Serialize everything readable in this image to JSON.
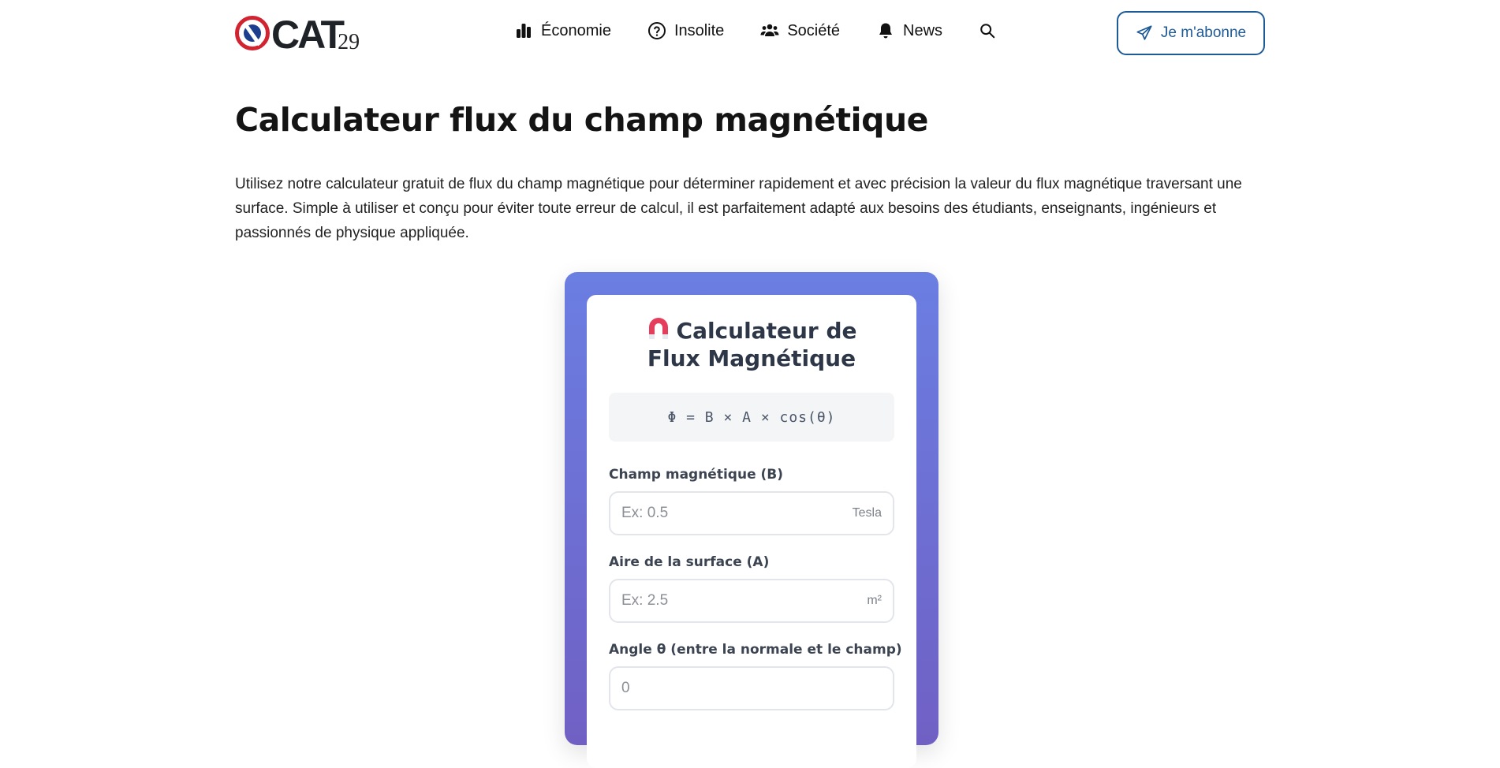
{
  "header": {
    "logo_text": "CAT",
    "logo_sub": "29",
    "nav": [
      {
        "label": "Économie",
        "icon": "bar-chart-icon"
      },
      {
        "label": "Insolite",
        "icon": "question-circle-icon"
      },
      {
        "label": "Société",
        "icon": "users-icon"
      },
      {
        "label": "News",
        "icon": "bell-icon"
      }
    ],
    "search_icon": "search-icon",
    "subscribe_label": "Je m'abonne",
    "subscribe_icon": "paper-plane-icon"
  },
  "main": {
    "title": "Calculateur flux du champ magnétique",
    "intro": "Utilisez notre calculateur gratuit de flux du champ magnétique pour déterminer rapidement et avec précision la valeur du flux magnétique traversant une surface. Simple à utiliser et conçu pour éviter toute erreur de calcul, il est parfaitement adapté aux besoins des étudiants, enseignants, ingénieurs et passionnés de physique appliquée."
  },
  "calculator": {
    "title_line1": "Calculateur de",
    "title_line2": "Flux Magnétique",
    "title_icon": "magnet-icon",
    "formula": "Φ = B × A × cos(θ)",
    "fields": [
      {
        "label": "Champ magnétique (B)",
        "placeholder": "Ex: 0.5",
        "unit": "Tesla"
      },
      {
        "label": "Aire de la surface (A)",
        "placeholder": "Ex: 2.5",
        "unit": "m²"
      },
      {
        "label": "Angle θ (entre la normale et le champ)",
        "placeholder": "0",
        "unit": ""
      }
    ]
  },
  "colors": {
    "accent": "#1e5a96",
    "logo_red": "#d12330",
    "logo_blue": "#1d3d8f",
    "card_gradient_top": "#6b7ee2",
    "card_gradient_bottom": "#7060c4",
    "magnet_red": "#e53e5c"
  }
}
